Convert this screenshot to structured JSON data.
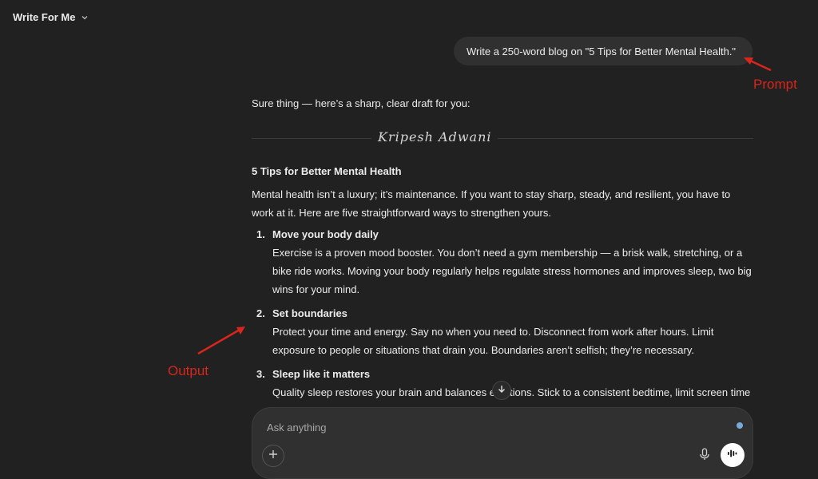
{
  "header": {
    "model_label": "Write For Me"
  },
  "conversation": {
    "user_prompt": "Write a 250-word blog on \"5 Tips for Better Mental Health.\"",
    "response": {
      "intro": "Sure thing — here’s a sharp, clear draft for you:",
      "signature": "Kripesh Adwani",
      "blog_title": "5 Tips for Better Mental Health",
      "blog_intro": "Mental health isn’t a luxury; it’s maintenance. If you want to stay sharp, steady, and resilient, you have to work at it. Here are five straightforward ways to strengthen yours.",
      "tips": [
        {
          "number": "1.",
          "title": "Move your body daily",
          "body": "Exercise is a proven mood booster. You don’t need a gym membership — a brisk walk, stretching, or a bike ride works. Moving your body regularly helps regulate stress hormones and improves sleep, two big wins for your mind."
        },
        {
          "number": "2.",
          "title": "Set boundaries",
          "body": "Protect your time and energy. Say no when you need to. Disconnect from work after hours. Limit exposure to people or situations that drain you. Boundaries aren’t selfish; they’re necessary."
        },
        {
          "number": "3.",
          "title": "Sleep like it matters",
          "body": "Quality sleep restores your brain and balances emotions. Stick to a consistent bedtime, limit screen time"
        }
      ]
    }
  },
  "annotations": {
    "prompt_label": "Prompt",
    "output_label": "Output",
    "color": "#d7261d"
  },
  "composer": {
    "placeholder": "Ask anything",
    "value": ""
  },
  "icons": {
    "header_chevron": "chevron-down-icon",
    "scroll": "arrow-down-icon",
    "add": "plus-icon",
    "mic": "microphone-icon",
    "voice": "voice-waveform-icon"
  },
  "colors": {
    "background": "#212121",
    "bubble": "#303030",
    "text": "#ececec",
    "annotation": "#d7261d"
  }
}
